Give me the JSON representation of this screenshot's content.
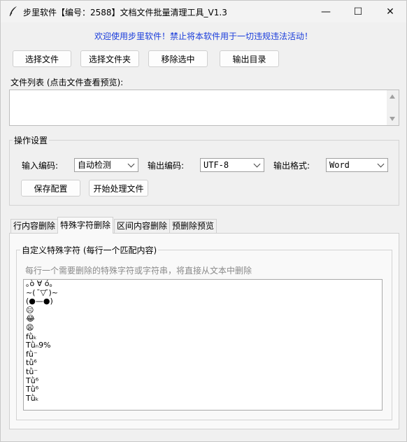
{
  "window": {
    "title": "步里软件【编号：2588】文档文件批量清理工具_V1.3",
    "minimize_glyph": "—",
    "maximize_glyph": "☐",
    "close_glyph": "✕"
  },
  "notice": "欢迎使用步里软件！禁止将本软件用于一切违规违法活动！",
  "toolbar": {
    "select_file": "选择文件",
    "select_folder": "选择文件夹",
    "remove_selected": "移除选中",
    "output_dir": "输出目录"
  },
  "file_list": {
    "label": "文件列表 (点击文件查看预览):",
    "items": []
  },
  "settings": {
    "title": "操作设置",
    "input_encoding_label": "输入编码:",
    "input_encoding_value": "自动检测",
    "output_encoding_label": "输出编码:",
    "output_encoding_value": "UTF-8",
    "output_format_label": "输出格式:",
    "output_format_value": "Word",
    "save_config": "保存配置",
    "start_processing": "开始处理文件"
  },
  "tabs": [
    {
      "label": "行内容删除",
      "active": false
    },
    {
      "label": "特殊字符删除",
      "active": true
    },
    {
      "label": "区间内容删除",
      "active": false
    },
    {
      "label": "预删除预览",
      "active": false
    }
  ],
  "special_chars": {
    "group_title": "自定义特殊字符 (每行一个匹配内容)",
    "hint": "每行一个需要删除的特殊字符或字符串，将直接从文本中删除",
    "lines": [
      "｡ò ∀ ó｡",
      "~(  ̄▽ ̄)~",
      "(●—●)",
      "☹",
      "😂",
      "😩",
      "fǜₖ",
      "Tǜₙ9%",
      "fǜ⁻",
      "tǜ⁶",
      "tǜ⁻",
      "Tǜ⁶",
      "Tǜ⁶",
      "Tǜₖ"
    ]
  }
}
